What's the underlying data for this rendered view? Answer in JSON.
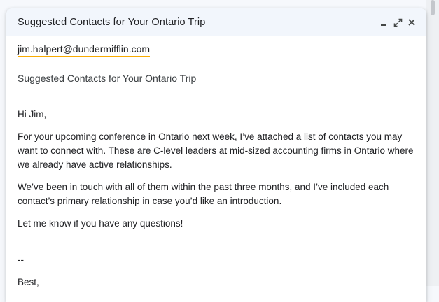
{
  "compose": {
    "title": "Suggested Contacts for Your Ontario Trip",
    "icons": [
      "minimize-icon",
      "expand-icon",
      "close-icon"
    ],
    "to_recipient": "jim.halpert@dundermifflin.com",
    "subject": "Suggested Contacts for Your Ontario Trip",
    "body": {
      "greeting": "Hi Jim,",
      "paragraph1": "For your upcoming conference in Ontario next week, I’ve attached a list of contacts you may want to connect with. These are C-level leaders at mid-sized accounting firms in Ontario where we already have active relationships.",
      "paragraph2": "We’ve been in touch with all of them within the past three months, and I’ve included each contact’s primary relationship in case you’d like an introduction.",
      "paragraph3": "Let me know if you have any questions!",
      "signature_dash": "--",
      "signature_closing": "Best,"
    }
  },
  "colors": {
    "title_bar_bg": "#f2f6fc",
    "recipient_underline": "#f9ab00"
  }
}
